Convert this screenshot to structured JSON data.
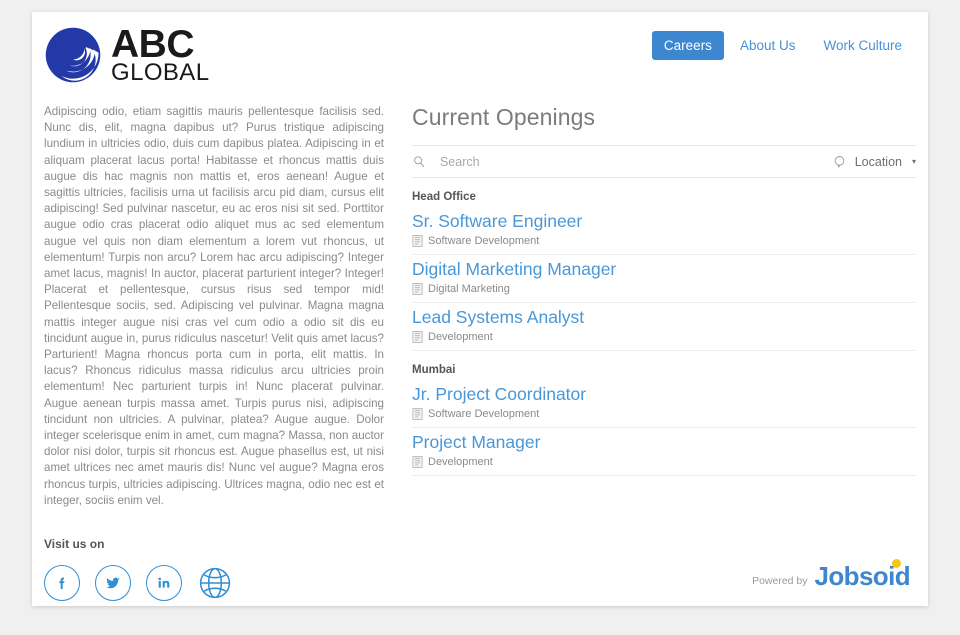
{
  "company": {
    "logo_name_primary": "ABC",
    "logo_name_secondary": "GLOBAL",
    "logo_icon": "swirl-circle-logo"
  },
  "nav": {
    "items": [
      {
        "label": "Careers",
        "active": true
      },
      {
        "label": "About Us",
        "active": false
      },
      {
        "label": "Work Culture",
        "active": false
      }
    ]
  },
  "about": {
    "text": "Adipiscing odio, etiam sagittis mauris pellentesque facilisis sed. Nunc dis, elit, magna dapibus ut? Purus tristique adipiscing lundium in ultricies odio, duis cum dapibus platea. Adipiscing in et aliquam placerat lacus porta! Habitasse et rhoncus mattis duis augue dis hac magnis non mattis et, eros aenean! Augue et sagittis ultricies, facilisis urna ut facilisis arcu pid diam, cursus elit adipiscing! Sed pulvinar nascetur, eu ac eros nisi sit sed. Porttitor augue odio cras placerat odio aliquet mus ac sed elementum augue vel quis non diam elementum a lorem vut rhoncus, ut elementum! Turpis non arcu? Lorem hac arcu adipiscing? Integer amet lacus, magnis! In auctor, placerat parturient integer? Integer! Placerat et pellentesque, cursus risus sed tempor mid! Pellentesque sociis, sed. Adipiscing vel pulvinar. Magna magna mattis integer augue nisi cras vel cum odio a odio sit dis eu tincidunt augue in, purus ridiculus nascetur! Velit quis amet lacus? Parturient! Magna rhoncus porta cum in porta, elit mattis. In lacus? Rhoncus ridiculus massa ridiculus arcu ultricies proin elementum! Nec parturient turpis in! Nunc placerat pulvinar. Augue aenean turpis massa amet. Turpis purus nisi, adipiscing tincidunt non ultricies. A pulvinar, platea? Augue augue. Dolor integer scelerisque enim in amet, cum magna? Massa, non auctor dolor nisi dolor, turpis sit rhoncus est. Augue phasellus est, ut nisi amet ultrices nec amet mauris dis! Nunc vel augue? Magna eros rhoncus turpis, ultricies adipiscing. Ultrices magna, odio nec est et integer, sociis enim vel."
  },
  "social": {
    "heading": "Visit us on",
    "items": [
      {
        "name": "facebook-icon"
      },
      {
        "name": "twitter-icon"
      },
      {
        "name": "linkedin-icon"
      },
      {
        "name": "website-globe-icon"
      }
    ]
  },
  "openings": {
    "title": "Current Openings",
    "search_placeholder": "Search",
    "search_value": "",
    "location_filter_label": "Location",
    "location_filter_caret": "▾",
    "groups": [
      {
        "location": "Head Office",
        "jobs": [
          {
            "title": "Sr. Software Engineer",
            "department": "Software Development"
          },
          {
            "title": "Digital Marketing Manager",
            "department": "Digital Marketing"
          },
          {
            "title": "Lead Systems Analyst",
            "department": "Development"
          }
        ]
      },
      {
        "location": "Mumbai",
        "jobs": [
          {
            "title": "Jr. Project Coordinator",
            "department": "Software Development"
          },
          {
            "title": "Project Manager",
            "department": "Development"
          }
        ]
      }
    ]
  },
  "footer": {
    "powered_by": "Powered by",
    "brand": "Jobsoid"
  },
  "colors": {
    "accent_blue": "#4a90d9",
    "active_tab_blue": "#3c87d0",
    "job_link_blue": "#4a97d8",
    "logo_blue": "#2339a8",
    "jobsoid_blue": "#3e86cd",
    "jobsoid_dot_yellow": "#f5c518",
    "page_background": "#f0f0f0",
    "card_background": "#ffffff"
  }
}
